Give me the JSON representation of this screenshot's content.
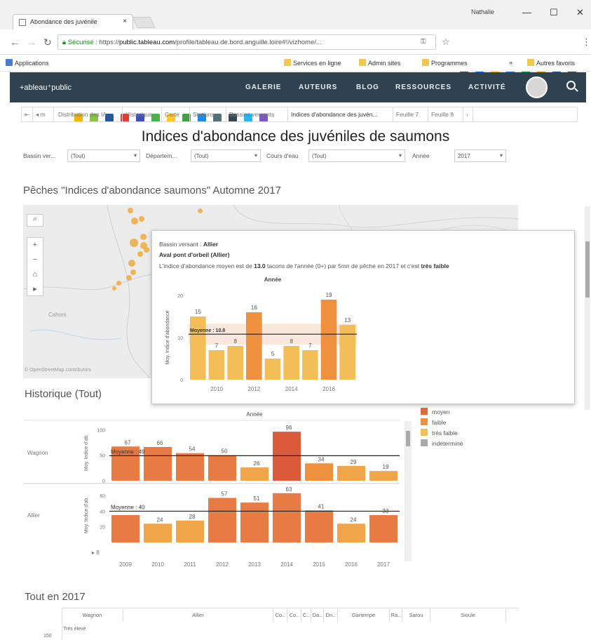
{
  "browser": {
    "tab_title": "Abondance des juvénile",
    "tab_close": "×",
    "user": "Nathalie",
    "url_secure": "Sécurisé",
    "url_scheme": "https://",
    "url_domain": "public.tableau.com",
    "url_path": "/profile/tableau.de.bord.anguille.loire#!/vizhome/...",
    "win_min": "—",
    "win_max": "☐",
    "win_close": "✕",
    "ext_colors": [
      "#555555",
      "#1a73e8",
      "#f4b400",
      "#3b7ddd",
      "#0f9d58",
      "#e5a100",
      "#2b5797",
      "#555555"
    ]
  },
  "bookmarks": {
    "apps": "Applications",
    "items": [
      "Services en ligne",
      "Admin sites",
      "Programmes"
    ],
    "more": "»",
    "others": "Autres favoris",
    "icon_colors": [
      "#f4b400",
      "#8bc34a",
      "#2b5797",
      "#e53935",
      "#3f51b5",
      "#4caf50",
      "#ffca28",
      "#43a047",
      "#1e88e5",
      "#546e7a",
      "#37474f",
      "#29b6f6",
      "#7e57c2"
    ]
  },
  "header": {
    "logo": "+ableau⁺public",
    "nav": [
      "GALERIE",
      "AUTEURS",
      "BLOG",
      "RESSOURCES",
      "ACTIVITÉ"
    ]
  },
  "sheet_tabs": {
    "items": [
      "Distribution des IA",
      "Historique",
      "Carte",
      "Stations",
      "Bassins versants",
      "Indices d'abondance des juvén...",
      "Feuille 7",
      "Feuille 8"
    ],
    "active_index": 5
  },
  "title": "Indices d'abondance des juvéniles de saumons",
  "filters": [
    {
      "label": "Bassin ver...",
      "value": "(Tout)"
    },
    {
      "label": "Départem...",
      "value": "(Tout)"
    },
    {
      "label": "Cours d'eau",
      "value": "(Tout)"
    },
    {
      "label": "Année",
      "value": "2017"
    }
  ],
  "map_section": {
    "title": "Pêches \"Indices d'abondance saumons\" Automne 2017",
    "credit": "© OpenStreetMap contributors",
    "place": "Cahors"
  },
  "tooltip": {
    "basin_label": "Bassin versant :",
    "basin_value": "Allier",
    "station": "Aval pont d'orbeil (Allier)",
    "sentence_pre": "L'indice d'abondance moyen est de",
    "sentence_value": "13.0",
    "sentence_mid": "tacons de l'année (0+) par 5mn de pêche en 2017 et c'est",
    "sentence_class": "très faible",
    "chart_title": "Année",
    "y_label": "Moy. Indice d'abondance",
    "mean_label": "Moyenne : 10.8"
  },
  "history_section": {
    "title": "Historique (Tout)",
    "chart_title": "Année",
    "rows": [
      "Wagnon",
      "Allier"
    ],
    "y_label": "Moy. Indice d'ab.",
    "mean_labels": [
      "Moyenne : 49",
      "Moyenne : 40"
    ]
  },
  "legend": [
    {
      "label": "moyen",
      "color": "#e06a3a"
    },
    {
      "label": "faible",
      "color": "#f0913f"
    },
    {
      "label": "très faible",
      "color": "#f3be58"
    },
    {
      "label": "indéterminé",
      "color": "#a9a9a9"
    }
  ],
  "bottom_section": {
    "title": "Tout en 2017",
    "columns": [
      "Wagnon",
      "Allier",
      "Co..",
      "Co..",
      "C..",
      "Da..",
      "Dn..",
      "Gartempe",
      "Ra..",
      "Sarou",
      "Sioule"
    ],
    "row_label": "Très élevé",
    "y_tick": "150"
  },
  "chart_data": [
    {
      "type": "bar",
      "title": "Année",
      "ylabel": "Moy. Indice d'abondance",
      "categories": [
        "2009",
        "2010",
        "2011",
        "2012",
        "2013",
        "2014",
        "2015",
        "2016",
        "2017"
      ],
      "values": [
        15,
        7,
        8,
        16,
        5,
        8,
        7,
        19,
        13
      ],
      "colors": [
        "#f3be58",
        "#f3be58",
        "#f3be58",
        "#f0913f",
        "#f3be58",
        "#f3be58",
        "#f3be58",
        "#f0913f",
        "#f3be58"
      ],
      "mean": 10.8,
      "ylim": [
        0,
        20
      ],
      "yticks": [
        0,
        10,
        20
      ],
      "xticks": [
        "2010",
        "2012",
        "2014",
        "2016"
      ]
    },
    {
      "type": "bar",
      "title": "Année",
      "categories": [
        "2009",
        "2010",
        "2011",
        "2012",
        "2013",
        "2014",
        "2015",
        "2016",
        "2017"
      ],
      "series": [
        {
          "name": "Wagnon",
          "values": [
            67,
            66,
            54,
            50,
            26,
            96,
            34,
            29,
            19
          ],
          "mean": 49,
          "colors": [
            "#e87a43",
            "#e87a43",
            "#e87a43",
            "#e87a43",
            "#f0a548",
            "#db5a3a",
            "#f0913f",
            "#f0a548",
            "#f0a548"
          ],
          "ylim": [
            0,
            110
          ],
          "yticks": [
            0,
            50,
            100
          ]
        },
        {
          "name": "Allier",
          "values": [
            35,
            24,
            28,
            57,
            51,
            63,
            41,
            24,
            35
          ],
          "mean": 40,
          "colors": [
            "#e87a43",
            "#f0a548",
            "#f0a548",
            "#e87a43",
            "#e87a43",
            "#e87a43",
            "#e87a43",
            "#f0a548",
            "#e87a43"
          ],
          "ylim": [
            0,
            70
          ],
          "yticks": [
            20,
            40,
            60
          ]
        }
      ],
      "value_labels": [
        [
          "67",
          "66",
          "54",
          "50",
          "26",
          "96",
          "34",
          "29",
          "19"
        ],
        [
          "",
          "24",
          "28",
          "57",
          "51",
          "63",
          "41",
          "24",
          "33"
        ]
      ]
    }
  ]
}
